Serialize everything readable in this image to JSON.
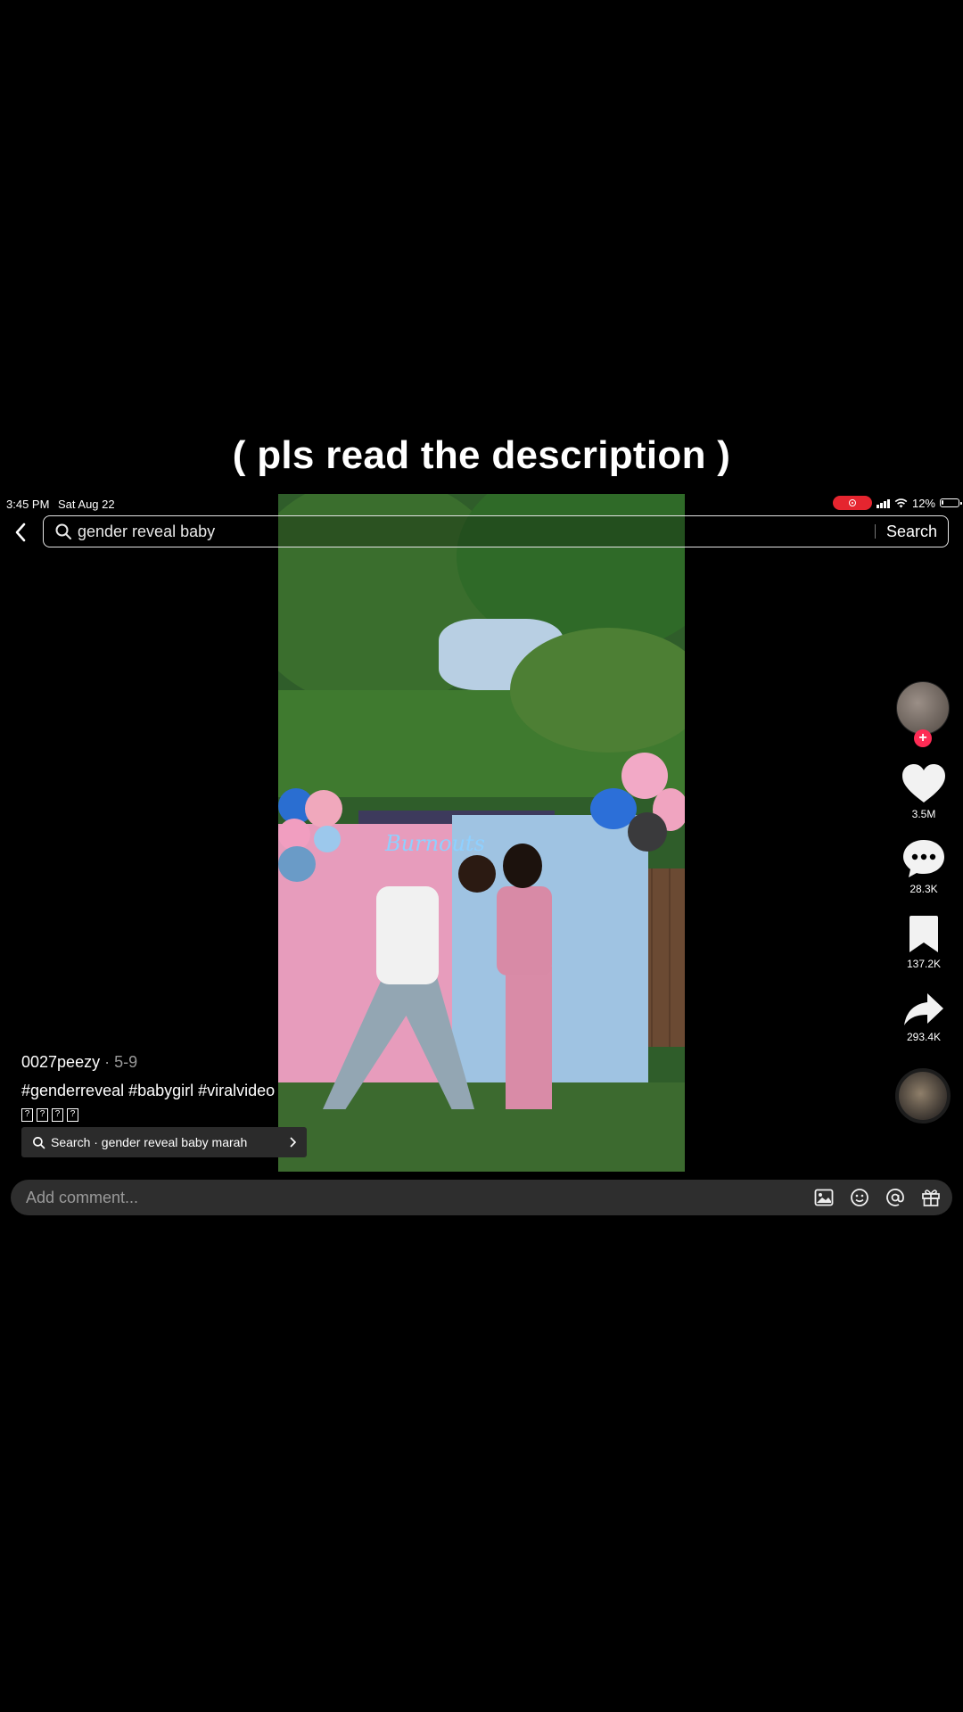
{
  "overlay_caption": "( pls read the description )",
  "status_bar": {
    "time": "3:45 PM",
    "date": "Sat Aug 22",
    "battery": "12%",
    "battery_level": 0.12
  },
  "search": {
    "query": "gender reveal baby",
    "submit_label": "Search"
  },
  "actions": {
    "likes": "3.5M",
    "comments": "28.3K",
    "saves": "137.2K",
    "shares": "293.4K"
  },
  "post": {
    "author": "0027peezy",
    "date": " · 5-9",
    "hashtags": "#genderreveal #babygirl #viralvideo",
    "unrendered_glyphs": "?",
    "related_search": "Search · gender reveal baby marah"
  },
  "comment_bar": {
    "placeholder": "Add comment..."
  },
  "icons": [
    "chevron-left-icon",
    "search-icon",
    "heart-icon",
    "comment-icon",
    "bookmark-icon",
    "share-icon",
    "image-icon",
    "emoji-icon",
    "mention-icon",
    "gift-icon",
    "chevron-right-icon"
  ],
  "colors": {
    "background": "#000000",
    "follow_accent": "#fe2c55",
    "recording_pill": "#e5252f",
    "comment_bar": "#2e2e2e"
  }
}
